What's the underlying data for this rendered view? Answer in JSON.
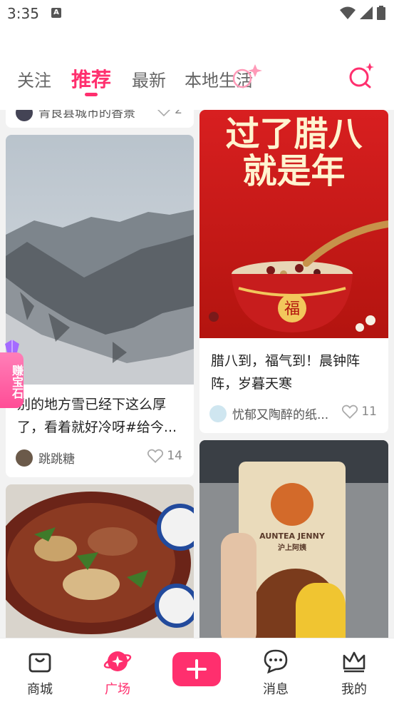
{
  "status_bar": {
    "time": "3:35"
  },
  "tabs": [
    "关注",
    "推荐",
    "最新",
    "本地生活"
  ],
  "active_tab": "推荐",
  "feed": {
    "left": [
      {
        "title": "青良县城市的香景",
        "author": "",
        "likes": "2"
      },
      {
        "title": "别的地方雪已经下这么厚了，看着就好冷呀#给今...",
        "author": "跳跳糖",
        "likes": "14"
      },
      {
        "title": "",
        "author": "",
        "likes": ""
      }
    ],
    "right": [
      {
        "poster_text_line1": "过了腊八",
        "poster_text_line2": "就是年",
        "bowl_char": "福",
        "title": "腊八到，福气到！晨钟阵阵，岁暮天寒",
        "author": "忧郁又陶醉的纸...",
        "likes": "11"
      },
      {
        "cup_brand": "AUNTEA JENNY",
        "cup_brand_cn": "沪上阿姨",
        "title": "",
        "author": "",
        "likes": ""
      }
    ]
  },
  "gem_badge": "赚宝石",
  "bottom_nav": [
    {
      "label": "商城",
      "icon": "bag-icon"
    },
    {
      "label": "广场",
      "icon": "planet-icon",
      "active": true
    },
    {
      "label": "",
      "icon": "plus-icon"
    },
    {
      "label": "消息",
      "icon": "chat-icon"
    },
    {
      "label": "我的",
      "icon": "crown-icon"
    }
  ],
  "colors": {
    "accent": "#ff2f6e"
  }
}
